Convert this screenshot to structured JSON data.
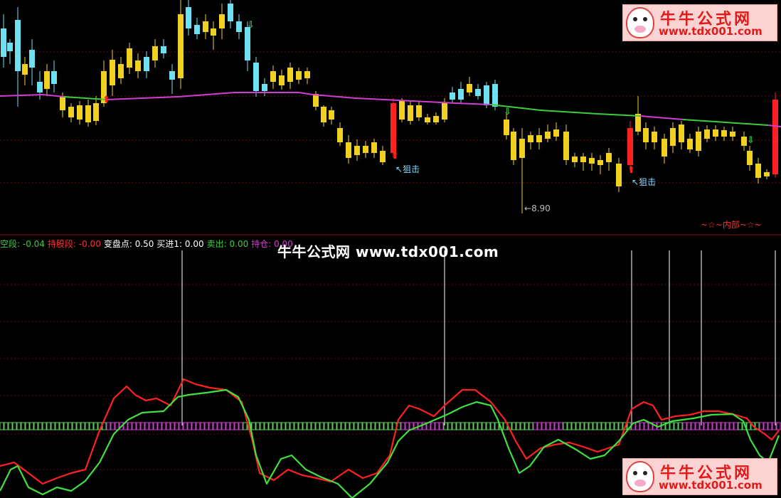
{
  "chart_data": {
    "type": "candlestick + oscillator",
    "price_panel": {
      "ma_color_up": "#d23cd2",
      "ma_color_down": "#3ccd3c",
      "low_marker_label": "8.90",
      "annotations": [
        "狙击",
        "狙击"
      ],
      "footer_label": "~☆~内部~☆~"
    },
    "indicator_panel": {
      "legend": [
        {
          "label": "空段:",
          "value": "-0.04",
          "color": "#3ccd3c"
        },
        {
          "label": "持股段:",
          "value": "-0.00",
          "color": "#ff3030"
        },
        {
          "label": "变盘点:",
          "value": "0.50",
          "color": "#ffffff"
        },
        {
          "label": "买进1:",
          "value": "0.00",
          "color": "#ffffff"
        },
        {
          "label": "卖出:",
          "value": "0.00",
          "color": "#3ccd3c"
        },
        {
          "label": "持仓:",
          "value": "0.00",
          "color": "#d23cd2"
        }
      ],
      "series": [
        {
          "color": "#ff2020"
        },
        {
          "color": "#40e040"
        }
      ]
    }
  },
  "watermark": {
    "center_text": "牛牛公式网 www.tdx001.com",
    "badge_title": "牛牛公式网",
    "badge_url": "www.tdx001.com"
  }
}
